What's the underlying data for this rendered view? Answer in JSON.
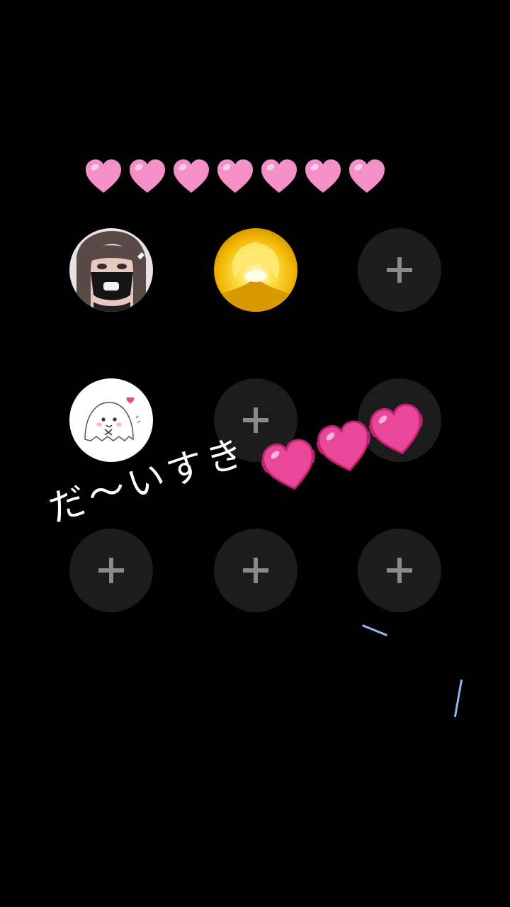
{
  "hearts_row": {
    "count": 7,
    "color": "#f48fc8",
    "icon": "pink-heart-icon"
  },
  "grid": {
    "rows": 3,
    "columns": 3,
    "empty_slot_color": "#1c1c1c",
    "plus_color": "#8a8a8a",
    "slots": [
      {
        "type": "avatar",
        "icon": "girl-avatar"
      },
      {
        "type": "avatar",
        "icon": "golden-light-avatar"
      },
      {
        "type": "empty",
        "icon": "plus-icon"
      },
      {
        "type": "avatar",
        "icon": "ghost-avatar"
      },
      {
        "type": "empty",
        "icon": "plus-icon"
      },
      {
        "type": "empty",
        "icon": "plus-icon"
      },
      {
        "type": "empty",
        "icon": "plus-icon"
      },
      {
        "type": "empty",
        "icon": "plus-icon"
      },
      {
        "type": "empty",
        "icon": "plus-icon"
      }
    ]
  },
  "sticker": {
    "text": "だ〜いすき",
    "heart_color": "#e8479a",
    "heart_count": 3
  }
}
